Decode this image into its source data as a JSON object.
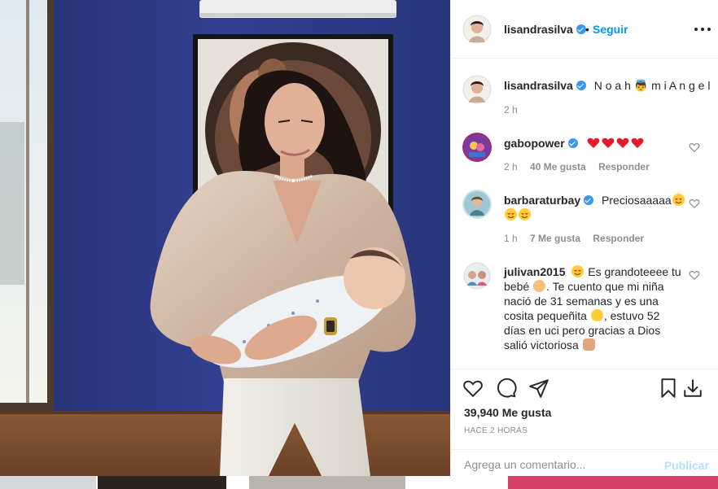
{
  "post": {
    "author": "lisandrasilva",
    "follow_label": "Seguir",
    "caption": "N o a h 👼 m i A n g e l",
    "caption_time": "2 h",
    "likes": "39,940 Me gusta",
    "time_ago": "HACE 2 HORAS"
  },
  "comments": [
    {
      "user": "gabopower",
      "verified": true,
      "text": "",
      "time": "2 h",
      "likes": "40 Me gusta",
      "reply": "Responder"
    },
    {
      "user": "barbaraturbay",
      "verified": true,
      "text": "Preciosaaaaa",
      "time": "1 h",
      "likes": "7 Me gusta",
      "reply": "Responder"
    },
    {
      "user": "julivan2015",
      "verified": false,
      "lines": [
        "Es grandoteeee tu",
        "bebé",
        ". Te cuento que mi niña",
        "nació de 31 semanas y es una",
        "cosita pequeñita",
        ", estuvo 52",
        "días en uci pero gracias a Dios",
        "salió victoriosa"
      ]
    }
  ],
  "composer": {
    "placeholder": "Agrega un comentario...",
    "publish": "Publicar"
  },
  "icons": {
    "more": "more-options-icon",
    "like": "heart-icon",
    "comment": "comment-icon",
    "share": "paper-plane-icon",
    "save": "bookmark-icon",
    "download": "download-icon",
    "verified": "verified-badge-icon"
  },
  "colors": {
    "accent": "#0095f6",
    "verified": "#3897f0",
    "heart": "#ed4956",
    "wall": "#2e3a80"
  }
}
